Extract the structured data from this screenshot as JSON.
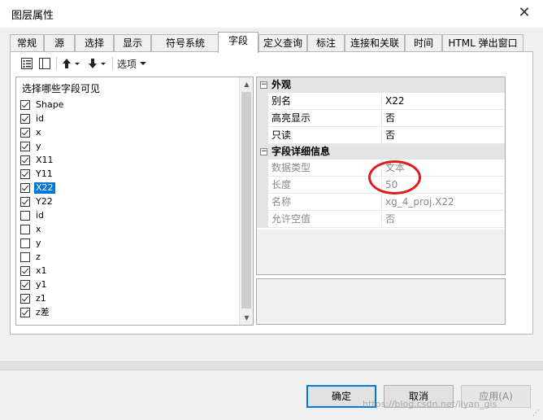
{
  "window": {
    "title": "图层属性",
    "close_glyph": "✕"
  },
  "tabs": [
    {
      "label": "常规"
    },
    {
      "label": "源"
    },
    {
      "label": "选择"
    },
    {
      "label": "显示"
    },
    {
      "label": "符号系统"
    },
    {
      "label": "字段",
      "active": true
    },
    {
      "label": "定义查询"
    },
    {
      "label": "标注"
    },
    {
      "label": "连接和关联"
    },
    {
      "label": "时间"
    },
    {
      "label": "HTML 弹出窗口"
    }
  ],
  "toolbar": {
    "options_label": "选项",
    "icons": [
      "list-view-icon",
      "table-view-icon",
      "arrow-up-icon",
      "arrow-down-icon",
      "options-dropdown-icon"
    ]
  },
  "field_list": {
    "header": "选择哪些字段可见",
    "items": [
      {
        "label": "Shape",
        "checked": true
      },
      {
        "label": "id",
        "checked": true
      },
      {
        "label": "x",
        "checked": true
      },
      {
        "label": "y",
        "checked": true
      },
      {
        "label": "X11",
        "checked": true
      },
      {
        "label": "Y11",
        "checked": true
      },
      {
        "label": "X22",
        "checked": true,
        "selected": true
      },
      {
        "label": "Y22",
        "checked": true
      },
      {
        "label": "id",
        "checked": false
      },
      {
        "label": "x",
        "checked": false
      },
      {
        "label": "y",
        "checked": false
      },
      {
        "label": "z",
        "checked": false
      },
      {
        "label": "x1",
        "checked": true
      },
      {
        "label": "y1",
        "checked": true
      },
      {
        "label": "z1",
        "checked": true
      },
      {
        "label": "z差",
        "checked": true
      }
    ]
  },
  "properties": {
    "appearance": {
      "label": "外观",
      "rows": [
        {
          "name": "别名",
          "value": "X22"
        },
        {
          "name": "高亮显示",
          "value": "否"
        },
        {
          "name": "只读",
          "value": "否"
        }
      ]
    },
    "details": {
      "label": "字段详细信息",
      "rows": [
        {
          "name": "数据类型",
          "value": "文本"
        },
        {
          "name": "长度",
          "value": "50"
        },
        {
          "name": "名称",
          "value": "xg_4_proj.X22"
        },
        {
          "name": "允许空值",
          "value": "否"
        }
      ]
    },
    "collapse_glyph": "−"
  },
  "annotation": {
    "color": "#e21a1a"
  },
  "buttons": {
    "ok": "确定",
    "cancel": "取消",
    "apply": "应用(A)"
  },
  "watermark": "https://blog.csdn.net/liyan_gis",
  "colors": {
    "selection": "#0078d7",
    "category_bg": "#e4e4e4",
    "readonly_text": "#8a8a8a"
  }
}
